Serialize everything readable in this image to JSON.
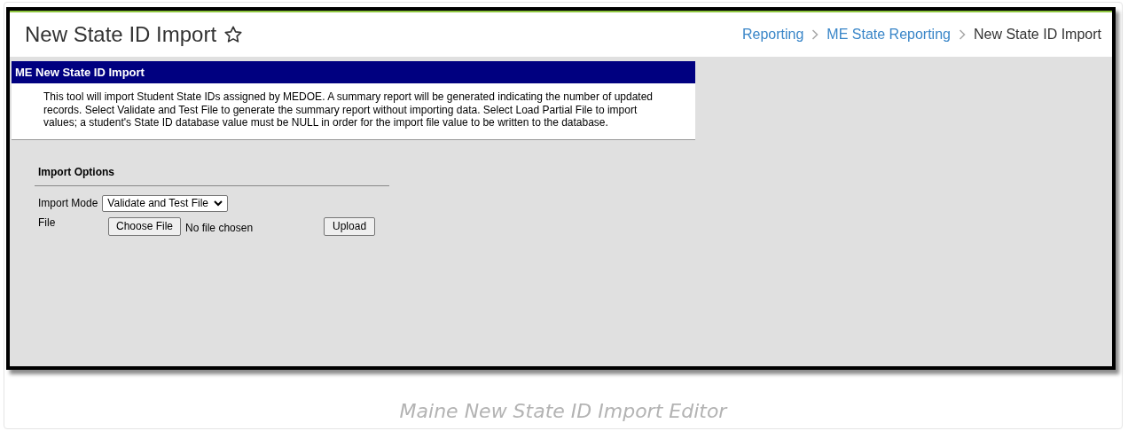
{
  "page": {
    "title": "New State ID Import"
  },
  "breadcrumbs": [
    {
      "label": "Reporting",
      "selected": false
    },
    {
      "label": "ME State Reporting",
      "selected": false
    },
    {
      "label": "New State ID Import",
      "selected": true
    }
  ],
  "panel": {
    "title": "ME New State ID Import",
    "description": "This tool will import Student State IDs assigned by MEDOE. A summary report will be generated indicating the number of updated records. Select Validate and Test File to generate the summary report without importing data. Select Load Partial File to import values; a student's State ID database value must be NULL in order for the import file value to be written to the database."
  },
  "import_options": {
    "title": "Import Options",
    "mode_label": "Import Mode",
    "mode_value": "Validate and Test File",
    "file_label": "File",
    "choose_button": "Choose File",
    "file_status": "No file chosen",
    "upload_button": "Upload"
  },
  "caption": "Maine New State ID Import Editor"
}
